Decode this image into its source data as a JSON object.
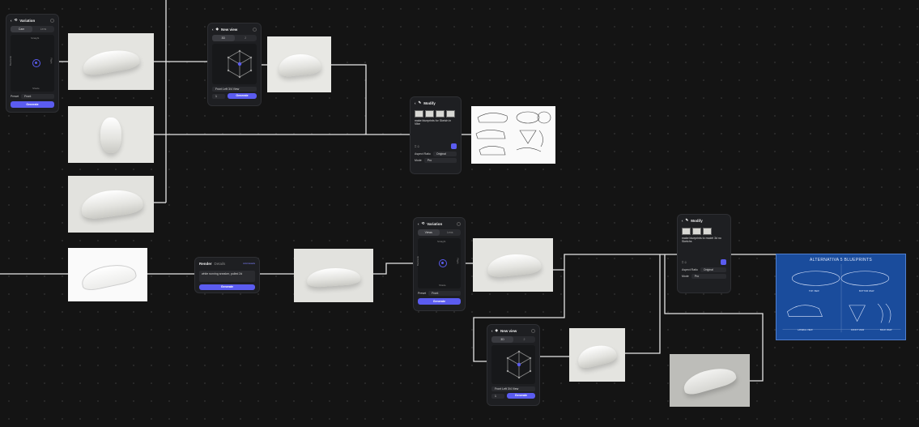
{
  "nodes": {
    "variation_1": {
      "title": "Variation",
      "tab_a": "Cam",
      "tab_b": "Lens",
      "top_label": "Straight",
      "bottom_label": "Shade",
      "left_label": "Backside",
      "right_label": "Right",
      "field_label": "Preset",
      "field_value": "Front",
      "button": "Generate"
    },
    "new_view_1": {
      "title": "New view",
      "tab_a": "3D",
      "tab_b": "2",
      "view_select": "Front Left 3/4 View",
      "count": "1",
      "button": "Generate"
    },
    "modify_1": {
      "title": "Modify",
      "prompt": "make blueprints for Sketch in Vibe",
      "aspect_label": "Aspect Ratio",
      "aspect_value": "Original",
      "mode_label": "Mode",
      "mode_value": "Pro"
    },
    "render_1": {
      "title": "Render",
      "tab": "Details",
      "link": "Add details",
      "prompt": "white running sneaker, pulled 2d",
      "button": "Generate"
    },
    "variation_2": {
      "title": "Variation",
      "tab_a": "Views",
      "tab_b": "Lens",
      "top_label": "Straight",
      "bottom_label": "Shade",
      "left_label": "Backside",
      "right_label": "Right",
      "field_label": "Preset",
      "field_value": "Front",
      "button": "Generate"
    },
    "new_view_2": {
      "title": "New view",
      "tab_a": "3D",
      "tab_b": "2",
      "view_select": "Front Left 3/4 View",
      "count": "1",
      "button": "Generate"
    },
    "modify_2": {
      "title": "Modify",
      "prompt": "make blueprints to model 3d no Sketchs",
      "aspect_label": "Aspect Ratio",
      "aspect_value": "Original",
      "mode_label": "Mode",
      "mode_value": "Pro"
    }
  },
  "blueprint": {
    "title": "ALTERNATIVA 5 BLUEPRINTS",
    "labels": [
      "TOP VIEW",
      "BOTTOM VIEW",
      "LATERAL VIEW",
      "FRONT VIEW",
      "BACK VIEW"
    ]
  },
  "colors": {
    "accent": "#5b5cf0",
    "canvas": "#141414",
    "panel": "#1e1f22",
    "wire": "#e8e8e8",
    "blueprint": "#1a4c9c"
  }
}
